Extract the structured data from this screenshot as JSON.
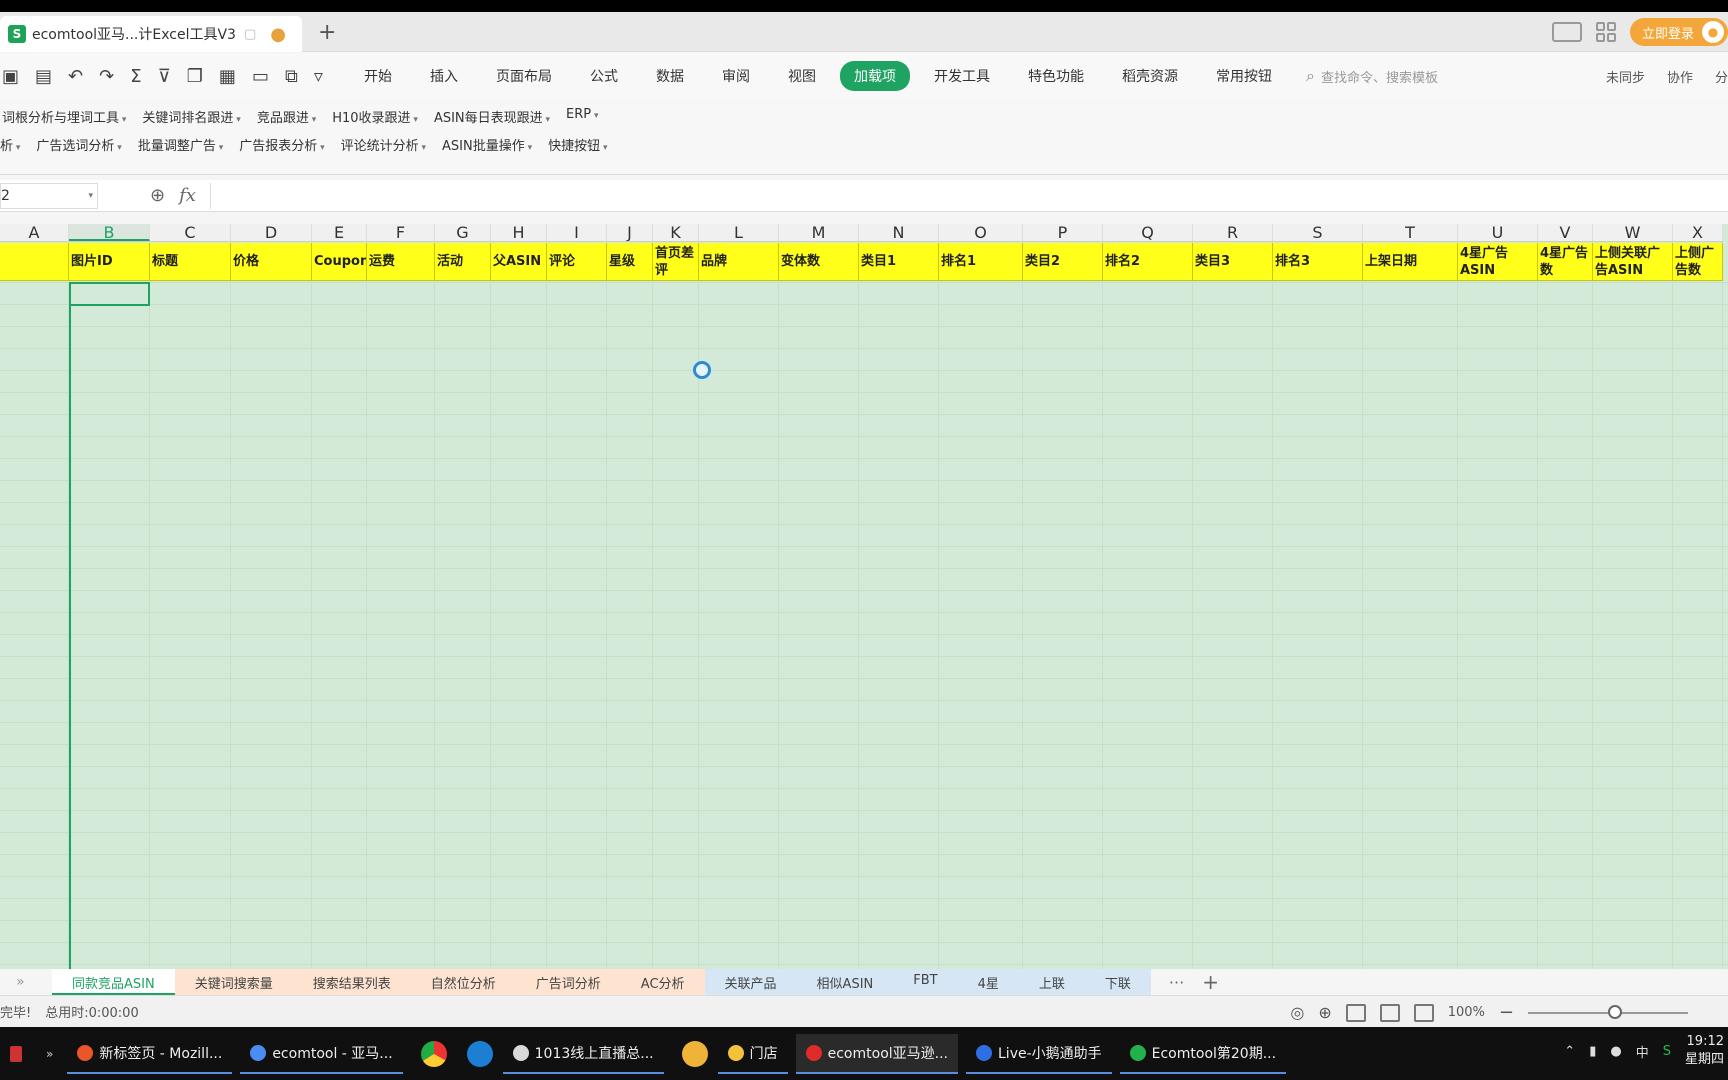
{
  "titlebar": {
    "doc_title": "ecomtool亚马...计Excel工具V3",
    "app_icon": "S",
    "new_tab": "+",
    "login_label": "立即登录"
  },
  "ribbon": {
    "tabs": [
      "开始",
      "插入",
      "页面布局",
      "公式",
      "数据",
      "审阅",
      "视图",
      "加载项",
      "开发工具",
      "特色功能",
      "稻壳资源",
      "常用按钮"
    ],
    "active_tab": "加载项",
    "search_placeholder": "查找命令、搜索模板",
    "right": [
      "未同步",
      "协作",
      "分"
    ]
  },
  "addins": {
    "row1": [
      "词根分析与埋词工具",
      "关键词排名跟进",
      "竞品跟进",
      "H10收录跟进",
      "ASIN每日表现跟进",
      "ERP"
    ],
    "row2": [
      "析",
      "广告选词分析",
      "批量调整广告",
      "广告报表分析",
      "评论统计分析",
      "ASIN批量操作",
      "快捷按钮"
    ]
  },
  "formula_bar": {
    "name_box": "2",
    "fx": "fx"
  },
  "columns": [
    "A",
    "B",
    "C",
    "D",
    "E",
    "F",
    "G",
    "H",
    "I",
    "J",
    "K",
    "L",
    "M",
    "N",
    "O",
    "P",
    "Q",
    "R",
    "S",
    "T",
    "U",
    "V",
    "W",
    "X"
  ],
  "selected_column": "B",
  "header_cells": [
    "",
    "图片ID",
    "标题",
    "价格",
    "Coupon",
    "运费",
    "活动",
    "父ASIN",
    "评论",
    "星级",
    "首页差评",
    "品牌",
    "变体数",
    "类目1",
    "排名1",
    "类目2",
    "排名2",
    "类目3",
    "排名3",
    "上架日期",
    "4星广告ASIN",
    "4星广告数",
    "上侧关联广告ASIN",
    "上侧广告数"
  ],
  "sheets": {
    "tabs": [
      {
        "label": "同款竞品ASIN",
        "color": "#ffffff",
        "text": "#1ea362"
      },
      {
        "label": "关键词搜索量",
        "color": "#fde3d0",
        "text": "#444"
      },
      {
        "label": "搜索结果列表",
        "color": "#fde3d0",
        "text": "#444"
      },
      {
        "label": "自然位分析",
        "color": "#fde3d0",
        "text": "#444"
      },
      {
        "label": "广告词分析",
        "color": "#fde3d0",
        "text": "#444"
      },
      {
        "label": "AC分析",
        "color": "#fde3d0",
        "text": "#444"
      },
      {
        "label": "关联产品",
        "color": "#d6e6f5",
        "text": "#444"
      },
      {
        "label": "相似ASIN",
        "color": "#d6e6f5",
        "text": "#444"
      },
      {
        "label": "FBT",
        "color": "#d6e6f5",
        "text": "#444"
      },
      {
        "label": "4星",
        "color": "#d6e6f5",
        "text": "#444"
      },
      {
        "label": "上联",
        "color": "#d6e6f5",
        "text": "#444"
      },
      {
        "label": "下联",
        "color": "#d6e6f5",
        "text": "#444"
      }
    ],
    "more": "···",
    "add": "+"
  },
  "status": {
    "left": "完毕!",
    "elapsed": "总用时:0:00:00",
    "zoom": "100%"
  },
  "taskbar": {
    "items": [
      {
        "label": "新标签页 - Mozill...",
        "icon": "#e8562a"
      },
      {
        "label": "ecomtool - 亚马...",
        "icon": "#4a8cf0"
      },
      {
        "label": "1013线上直播总...",
        "icon": "#d9d9d9"
      },
      {
        "label": "门店",
        "icon": "#f2c23a"
      },
      {
        "label": "ecomtool亚马逊...",
        "icon": "#e02b2b"
      },
      {
        "label": "Live-小鹅通助手",
        "icon": "#2f6fe3"
      },
      {
        "label": "Ecomtool第20期...",
        "icon": "#22b24c"
      }
    ],
    "clock_time": "19:12",
    "clock_day": "星期四",
    "ime": "中"
  }
}
